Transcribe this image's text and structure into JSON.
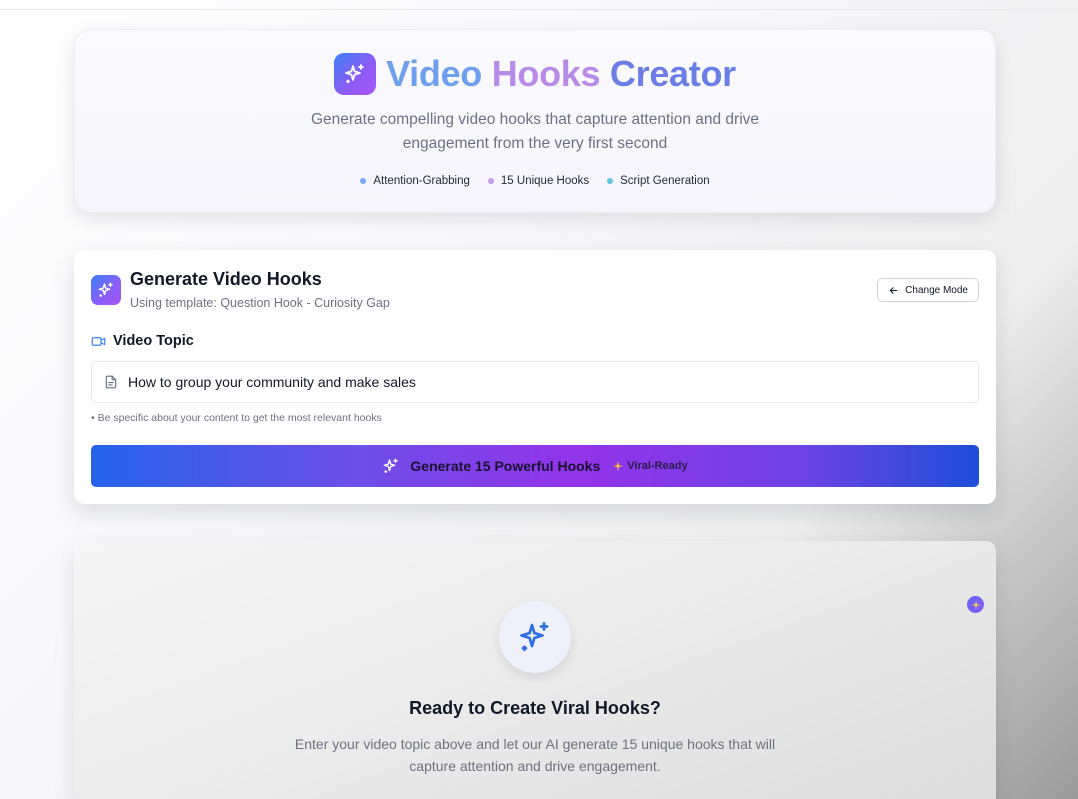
{
  "hero": {
    "title_part1": "Video",
    "title_part2": "Hooks",
    "title_part3": "Creator",
    "subtitle_line1": "Generate compelling video hooks that capture attention and drive",
    "subtitle_line2": "engagement from the very first second",
    "features": [
      {
        "label": "Attention-Grabbing",
        "color": "#60a5fa"
      },
      {
        "label": "15 Unique Hooks",
        "color": "#c084fc"
      },
      {
        "label": "Script Generation",
        "color": "#22d3ee"
      }
    ]
  },
  "generator": {
    "title": "Generate Video Hooks",
    "subtitle": "Using template: Question Hook - Curiosity Gap",
    "change_mode_label": "Change Mode",
    "topic_label": "Video Topic",
    "topic_value": "How to group your community and make sales",
    "hint": "• Be specific about your content to get the most relevant hooks",
    "generate_label": "Generate 15 Powerful Hooks",
    "viral_label": "Viral-Ready"
  },
  "ready": {
    "title": "Ready to Create Viral Hooks?",
    "desc_line1": "Enter your video topic above and let our AI generate 15 unique hooks that will",
    "desc_line2": "capture attention and drive engagement."
  },
  "colors": {
    "accent_blue": "#2563eb",
    "accent_purple": "#9333ea",
    "icon_blue": "#2f6fe0"
  },
  "icons": [
    "sparkles-icon",
    "arrow-left-icon",
    "video-icon",
    "document-icon",
    "sparkle-small-icon"
  ]
}
